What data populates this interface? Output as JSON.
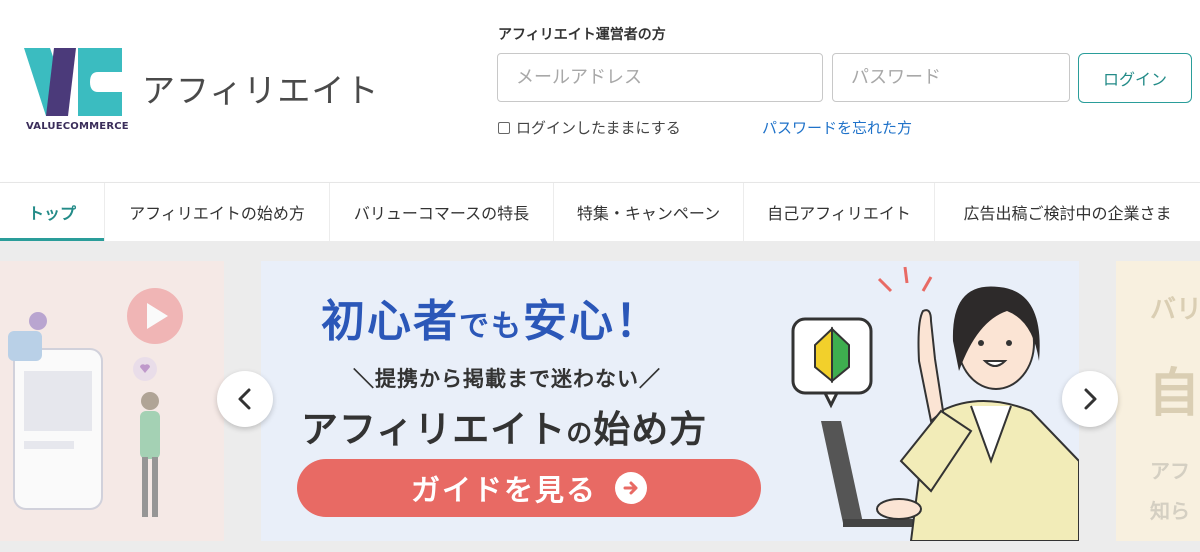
{
  "brand": {
    "logo_text": "VALUECOMMERCE",
    "title": "アフィリエイト"
  },
  "login": {
    "heading": "アフィリエイト運営者の方",
    "email_placeholder": "メールアドレス",
    "password_placeholder": "パスワード",
    "button_label": "ログイン",
    "remember_label": "ログインしたままにする",
    "forgot_label": "パスワードを忘れた方"
  },
  "nav": {
    "items": [
      {
        "label": "トップ"
      },
      {
        "label": "アフィリエイトの始め方"
      },
      {
        "label": "バリューコマースの特長"
      },
      {
        "label": "特集・キャンペーン"
      },
      {
        "label": "自己アフィリエイト"
      },
      {
        "label": "広告出稿ご検討中の企業さま"
      }
    ]
  },
  "banner": {
    "title_a": "初心者",
    "title_b": "でも",
    "title_c": "安心！",
    "subtitle": "＼提携から掲載まで迷わない／",
    "main_a": "アフィリエイト",
    "main_b": "の",
    "main_c": "始め方",
    "cta_label": "ガイドを見る"
  },
  "next_slide": {
    "top": "バリ",
    "big": "自",
    "line1": "アフ",
    "line2": "知ら"
  },
  "colors": {
    "accent": "#2a9d9a",
    "link": "#1f72c9",
    "banner_blue": "#2b57b8",
    "cta": "#e86a64",
    "logo_teal": "#3bbcc0",
    "logo_purple": "#4b3a7a"
  },
  "icons": {
    "carousel_prev": "chevron-left-icon",
    "carousel_next": "chevron-right-icon",
    "cta_arrow": "arrow-right-circle-icon",
    "beginner": "beginner-mark-icon"
  }
}
